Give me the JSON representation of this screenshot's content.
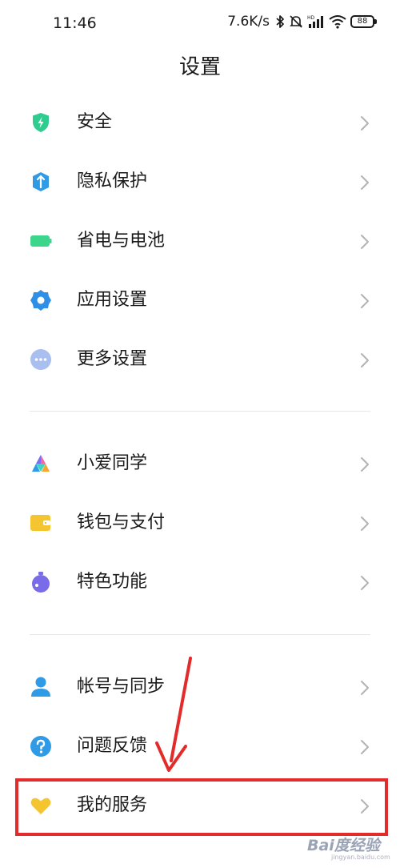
{
  "status_bar": {
    "time": "11:46",
    "speed": "7.6K/s",
    "battery": "88",
    "icons": [
      "bluetooth-icon",
      "mute-icon",
      "hd-signal-icon",
      "wifi-icon",
      "battery-icon"
    ]
  },
  "page": {
    "title": "设置"
  },
  "groups": [
    {
      "items": [
        {
          "label": "安全",
          "icon": "shield-icon",
          "icon_color": "#2ecc8f"
        },
        {
          "label": "隐私保护",
          "icon": "privacy-icon",
          "icon_color": "#2f9be6"
        },
        {
          "label": "省电与电池",
          "icon": "battery-saver-icon",
          "icon_color": "#3bd68c"
        },
        {
          "label": "应用设置",
          "icon": "app-settings-icon",
          "icon_color": "#2f8fe6"
        },
        {
          "label": "更多设置",
          "icon": "more-settings-icon",
          "icon_color": "#a9bff0"
        }
      ]
    },
    {
      "items": [
        {
          "label": "小爱同学",
          "icon": "xiaoai-icon",
          "icon_color": "#7b6cf0"
        },
        {
          "label": "钱包与支付",
          "icon": "wallet-icon",
          "icon_color": "#f5c531"
        },
        {
          "label": "特色功能",
          "icon": "feature-icon",
          "icon_color": "#7a6ce8"
        }
      ]
    },
    {
      "items": [
        {
          "label": "帐号与同步",
          "icon": "account-icon",
          "icon_color": "#2f9be6"
        },
        {
          "label": "问题反馈",
          "icon": "feedback-icon",
          "icon_color": "#2f9be6"
        },
        {
          "label": "我的服务",
          "icon": "heart-icon",
          "icon_color": "#f5c531"
        }
      ]
    }
  ],
  "annotation": {
    "color": "#e32b2b"
  },
  "watermark": {
    "text": "Bai度经验",
    "sub": "jingyan.baidu.com"
  }
}
